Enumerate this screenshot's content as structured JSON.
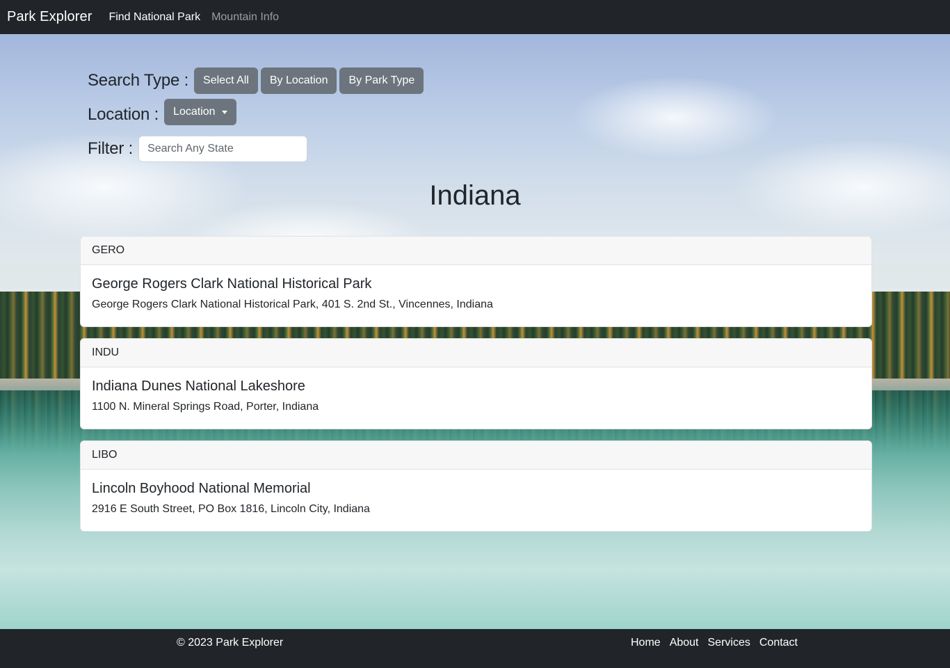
{
  "navbar": {
    "brand": "Park Explorer",
    "links": [
      {
        "label": "Find National Park",
        "active": true
      },
      {
        "label": "Mountain Info",
        "active": false
      }
    ]
  },
  "search_type": {
    "label": "Search Type :",
    "buttons": [
      "Select All",
      "By Location",
      "By Park Type"
    ]
  },
  "location": {
    "label": "Location :",
    "dropdown_label": "Location"
  },
  "filter": {
    "label": "Filter :",
    "placeholder": "Search Any State",
    "value": ""
  },
  "state_heading": "Indiana",
  "parks": [
    {
      "code": "GERO",
      "name": "George Rogers Clark National Historical Park",
      "address": "George Rogers Clark National Historical Park, 401 S. 2nd St., Vincennes, Indiana"
    },
    {
      "code": "INDU",
      "name": "Indiana Dunes National Lakeshore",
      "address": "1100 N. Mineral Springs Road, Porter, Indiana"
    },
    {
      "code": "LIBO",
      "name": "Lincoln Boyhood National Memorial",
      "address": "2916 E South Street, PO Box 1816, Lincoln City, Indiana"
    }
  ],
  "footer": {
    "copyright": "© 2023 Park Explorer",
    "links": [
      "Home",
      "About",
      "Services",
      "Contact"
    ]
  },
  "colors": {
    "navbar_bg": "#212529",
    "button_bg": "#6c757d",
    "card_header_bg": "#f7f7f7"
  }
}
